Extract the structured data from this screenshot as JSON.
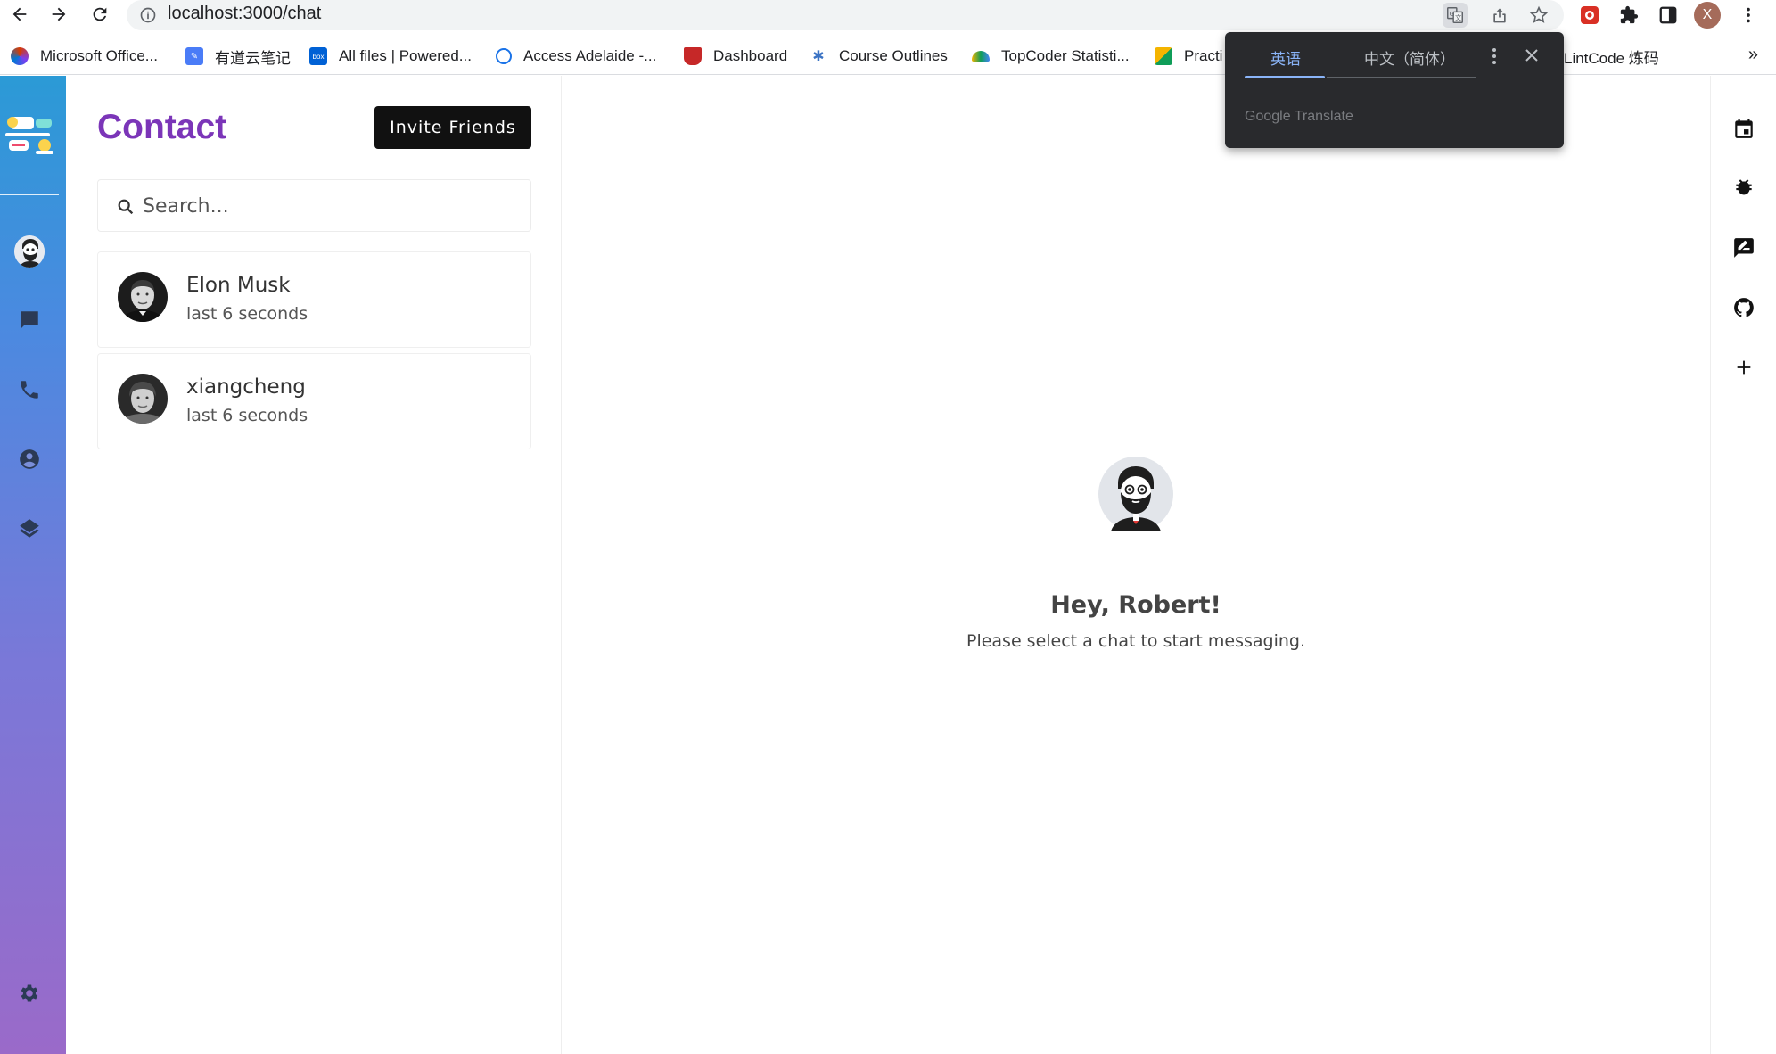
{
  "browser": {
    "url": "localhost:3000/chat",
    "profile_initial": "X",
    "bookmarks": [
      {
        "label": "Microsoft Office...",
        "icon": "office-icon"
      },
      {
        "label": "有道云笔记",
        "icon": "youdao-note-icon"
      },
      {
        "label": "All files | Powered...",
        "icon": "box-icon"
      },
      {
        "label": "Access Adelaide -...",
        "icon": "access-adelaide-icon"
      },
      {
        "label": "Dashboard",
        "icon": "university-crest-icon"
      },
      {
        "label": "Course Outlines",
        "icon": "sparkle-icon"
      },
      {
        "label": "TopCoder Statisti...",
        "icon": "topcoder-icon"
      },
      {
        "label": "Practi",
        "icon": "folder-icon"
      },
      {
        "label": "LintCode 炼码",
        "icon": "lintcode-icon"
      }
    ],
    "more_label": "»"
  },
  "translate_popup": {
    "tab_active": "英语",
    "tab_inactive": "中文（简体）",
    "brand": "Google Translate"
  },
  "contacts": {
    "title": "Contact",
    "invite_label": "Invite Friends",
    "search_placeholder": "Search...",
    "list": [
      {
        "name": "Elon Musk",
        "status": "last 6 seconds"
      },
      {
        "name": "xiangcheng",
        "status": "last 6 seconds"
      }
    ]
  },
  "main": {
    "greeting": "Hey, Robert!",
    "subtitle": "Please select a chat to start messaging."
  },
  "colors": {
    "accent": "#7b35b8",
    "sidebar_top": "#2b9ad6",
    "sidebar_bottom": "#9a6ac9",
    "button_bg": "#111111",
    "translate_bg": "#292a2d",
    "translate_active": "#8ab4f8"
  }
}
